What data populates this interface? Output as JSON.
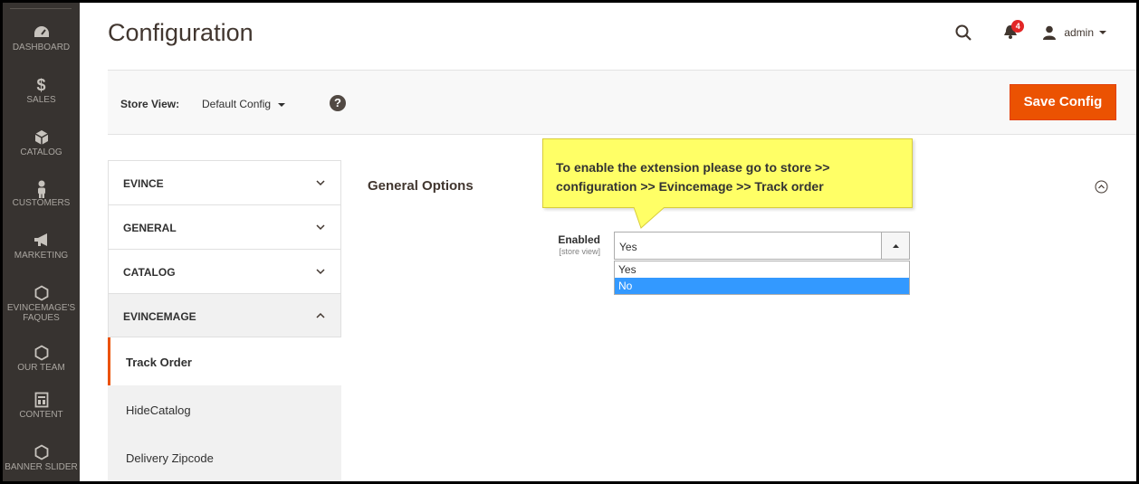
{
  "sidebar": {
    "items": [
      {
        "label": "DASHBOARD",
        "icon": "dashboard-icon"
      },
      {
        "label": "SALES",
        "icon": "dollar-icon"
      },
      {
        "label": "CATALOG",
        "icon": "cube-icon"
      },
      {
        "label": "CUSTOMERS",
        "icon": "person-icon"
      },
      {
        "label": "MARKETING",
        "icon": "megaphone-icon"
      },
      {
        "label": "EVINCEMAGE'S",
        "label2": "FAQUES",
        "icon": "hexagon-icon"
      },
      {
        "label": "OUR TEAM",
        "icon": "hexagon-icon"
      },
      {
        "label": "CONTENT",
        "icon": "content-icon"
      },
      {
        "label": "BANNER SLIDER",
        "icon": "hexagon-icon"
      }
    ]
  },
  "header": {
    "title": "Configuration",
    "notification_count": "4",
    "user": "admin"
  },
  "store_bar": {
    "label": "Store View:",
    "selected": "Default Config",
    "help": "?",
    "save_label": "Save Config"
  },
  "tabs": [
    {
      "label": "EVINCE",
      "open": false
    },
    {
      "label": "GENERAL",
      "open": false
    },
    {
      "label": "CATALOG",
      "open": false
    },
    {
      "label": "EVINCEMAGE",
      "open": true
    }
  ],
  "subtabs": [
    {
      "label": "Track Order",
      "active": true
    },
    {
      "label": "HideCatalog",
      "active": false
    },
    {
      "label": "Delivery Zipcode",
      "active": false
    }
  ],
  "section": {
    "title": "General Options",
    "field_label": "Enabled",
    "field_scope": "[store view]",
    "field_value": "Yes",
    "options": [
      "Yes",
      "No"
    ],
    "highlighted_option": "No"
  },
  "callout": {
    "line1": "To enable the extension please go to store >>",
    "line2": "configuration >> Evincemage >> Track order"
  },
  "colors": {
    "accent": "#eb5202",
    "sidebar_bg": "#373330",
    "callout_bg": "#ffff66",
    "option_highlight": "#3399ff"
  }
}
